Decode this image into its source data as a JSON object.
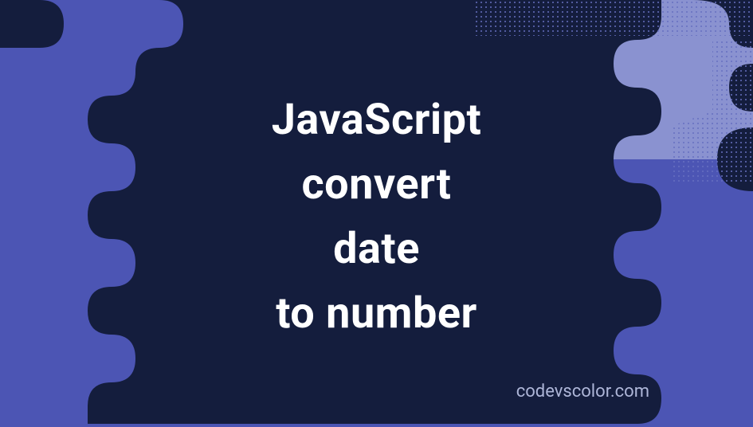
{
  "title": {
    "line1": "JavaScript",
    "line2": "convert",
    "line3": "date",
    "line4": "to number"
  },
  "watermark": "codevscolor.com",
  "colors": {
    "background": "#4c55b4",
    "blob": "#141d3d",
    "text": "#ffffff",
    "watermarkText": "#aeb6d8",
    "lightBg": "#8a92d0"
  }
}
